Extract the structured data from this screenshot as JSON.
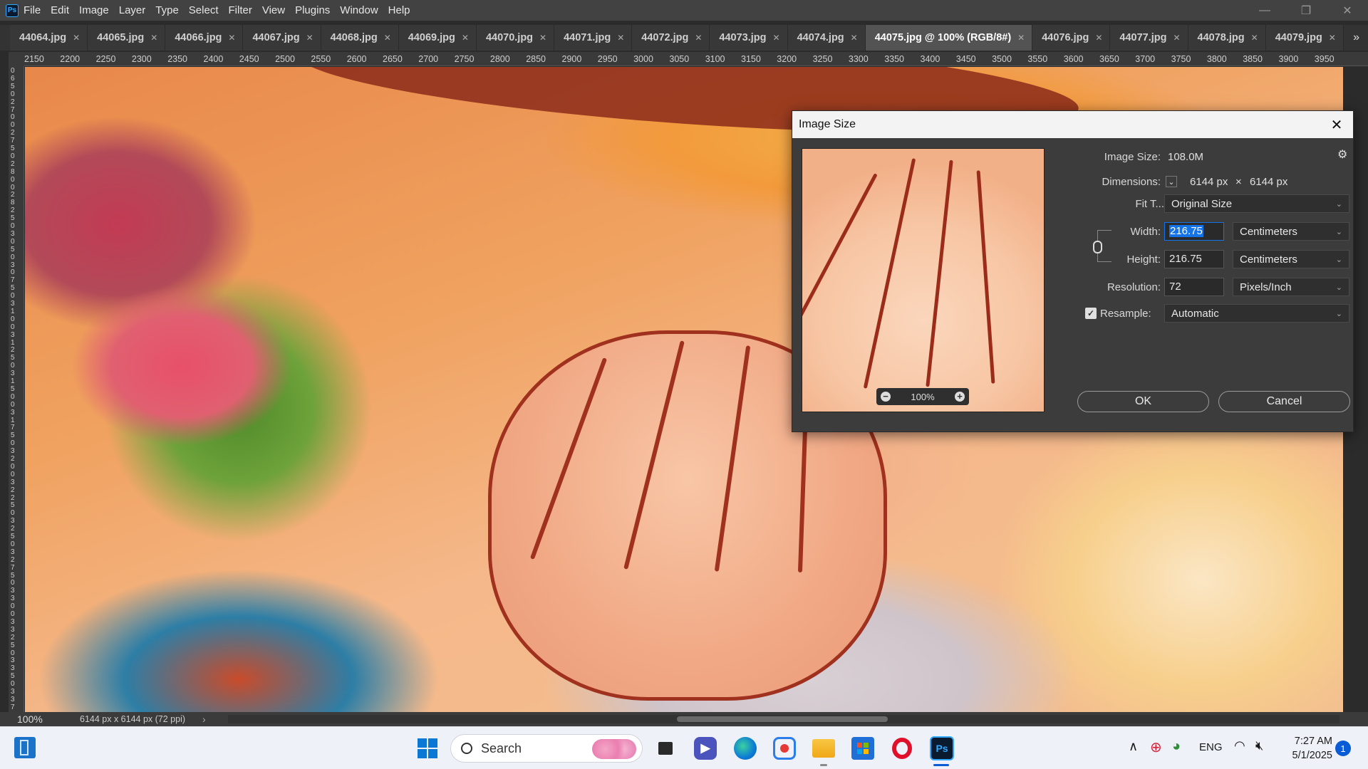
{
  "menubar": {
    "logo": "Ps",
    "items": [
      "File",
      "Edit",
      "Image",
      "Layer",
      "Type",
      "Select",
      "Filter",
      "View",
      "Plugins",
      "Window",
      "Help"
    ],
    "window_controls": {
      "minimize": "—",
      "restore": "❐",
      "close": "✕"
    }
  },
  "tabs": [
    {
      "label": "44064.jpg",
      "active": false
    },
    {
      "label": "44065.jpg",
      "active": false
    },
    {
      "label": "44066.jpg",
      "active": false
    },
    {
      "label": "44067.jpg",
      "active": false
    },
    {
      "label": "44068.jpg",
      "active": false
    },
    {
      "label": "44069.jpg",
      "active": false
    },
    {
      "label": "44070.jpg",
      "active": false
    },
    {
      "label": "44071.jpg",
      "active": false
    },
    {
      "label": "44072.jpg",
      "active": false
    },
    {
      "label": "44073.jpg",
      "active": false
    },
    {
      "label": "44074.jpg",
      "active": false
    },
    {
      "label": "44075.jpg @ 100% (RGB/8#)",
      "active": true
    },
    {
      "label": "44076.jpg",
      "active": false
    },
    {
      "label": "44077.jpg",
      "active": false
    },
    {
      "label": "44078.jpg",
      "active": false
    },
    {
      "label": "44079.jpg",
      "active": false
    }
  ],
  "tab_close_glyph": "✕",
  "tab_overflow": "»",
  "ruler_top": [
    "2150",
    "2200",
    "2250",
    "2300",
    "2350",
    "2400",
    "2450",
    "2500",
    "2550",
    "2600",
    "2650",
    "2700",
    "2750",
    "2800",
    "2850",
    "2900",
    "2950",
    "3000",
    "3050",
    "3100",
    "3150",
    "3200",
    "3250",
    "3300",
    "3350",
    "3400",
    "3450",
    "3500",
    "3550",
    "3600",
    "3650",
    "3700",
    "3750",
    "3800",
    "3850",
    "3900",
    "3950"
  ],
  "ruler_left": [
    "0",
    "6",
    "5",
    "0",
    "2",
    "7",
    "0",
    "0",
    "2",
    "7",
    "5",
    "0",
    "2",
    "8",
    "0",
    "0",
    "2",
    "8",
    "2",
    "5",
    "0",
    "3",
    "0",
    "5",
    "0",
    "3",
    "0",
    "7",
    "5",
    "0",
    "3",
    "1",
    "0",
    "0",
    "3",
    "1",
    "2",
    "5",
    "0",
    "3",
    "1",
    "5",
    "0",
    "0",
    "3",
    "1",
    "7",
    "5",
    "0",
    "3",
    "2",
    "0",
    "0",
    "3",
    "2",
    "2",
    "5",
    "0",
    "3",
    "2",
    "5",
    "0",
    "3",
    "2",
    "7",
    "5",
    "0",
    "3",
    "3",
    "0",
    "0",
    "3",
    "3",
    "2",
    "5",
    "0",
    "3",
    "3",
    "5",
    "0",
    "3",
    "3",
    "7",
    "5"
  ],
  "status": {
    "zoom": "100%",
    "dimensions": "6144 px x 6144 px (72 ppi)",
    "arrow": "›"
  },
  "dialog": {
    "title": "Image Size",
    "close": "✕",
    "gear": "⚙",
    "image_size_label": "Image Size:",
    "image_size_value": "108.0M",
    "dimensions_label": "Dimensions:",
    "dim_width": "6144 px",
    "dim_x": "×",
    "dim_height": "6144 px",
    "fit_label": "Fit T...",
    "fit_value": "Original Size",
    "width_label": "Width:",
    "width_value": "216.75",
    "width_unit": "Centimeters",
    "height_label": "Height:",
    "height_value": "216.75",
    "height_unit": "Centimeters",
    "resolution_label": "Resolution:",
    "resolution_value": "72",
    "resolution_unit": "Pixels/Inch",
    "resample_label": "Resample:",
    "resample_checked": true,
    "resample_value": "Automatic",
    "preview_zoom": "100%",
    "ok_label": "OK",
    "cancel_label": "Cancel"
  },
  "taskbar": {
    "search_placeholder": "Search",
    "language": "ENG",
    "time": "7:27 AM",
    "date": "5/1/2025",
    "notifications": "1"
  },
  "colors": {
    "accent_blue": "#1473e6",
    "ps_blue": "#31a8ff",
    "dialog_bg": "#3c3c3c",
    "menubar_bg": "#424242",
    "taskbar_bg": "#eef1f7"
  }
}
